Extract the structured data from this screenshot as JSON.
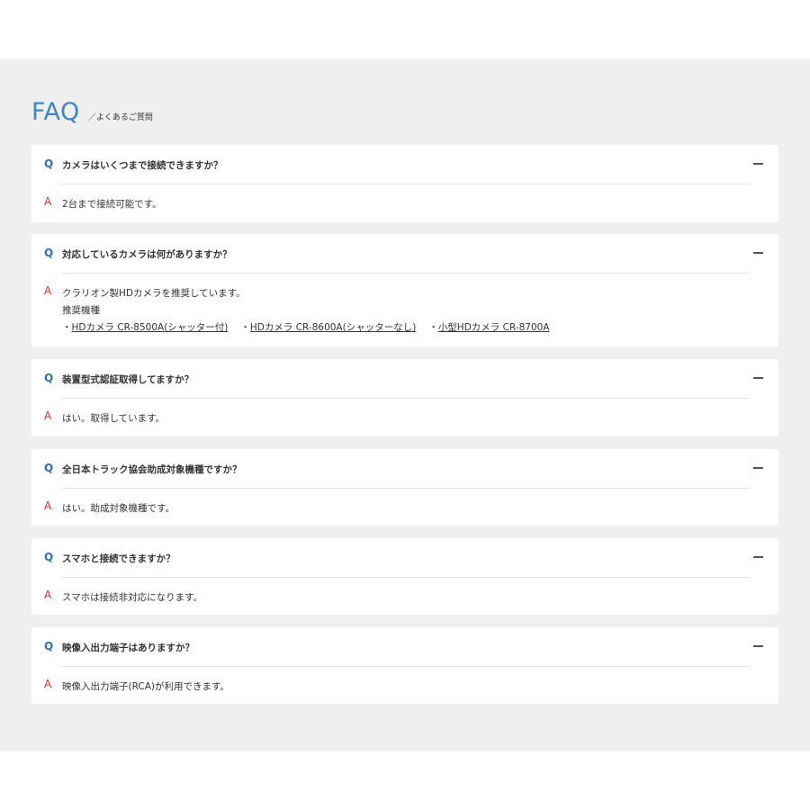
{
  "header": {
    "title": "FAQ",
    "subtitle": "／よくあるご質問"
  },
  "marks": {
    "q": "Q",
    "a": "A"
  },
  "faqs": [
    {
      "question": "カメラはいくつまで接続できますか？",
      "answer": "2台まで接続可能です。"
    },
    {
      "question": "対応しているカメラは何がありますか？",
      "answer": "クラリオン製HDカメラを推奨しています。",
      "sub_label": "推奨機種",
      "links": [
        {
          "prefix": "・",
          "label": "HDカメラ CR-8500A(シャッター付)"
        },
        {
          "prefix": "・",
          "label": "HDカメラ CR-8600A(シャッターなし)"
        },
        {
          "prefix": "・",
          "label": "小型HDカメラ CR-8700A"
        }
      ]
    },
    {
      "question": "装置型式認証取得してますか？",
      "answer": "はい。取得しています。"
    },
    {
      "question": "全日本トラック協会助成対象機種ですか？",
      "answer": "はい。助成対象機種です。"
    },
    {
      "question": "スマホと接続できますか？",
      "answer": "スマホは接続非対応になります。"
    },
    {
      "question": "映像入出力端子はありますか？",
      "answer": "映像入出力端子(RCA)が利用できます。"
    }
  ]
}
